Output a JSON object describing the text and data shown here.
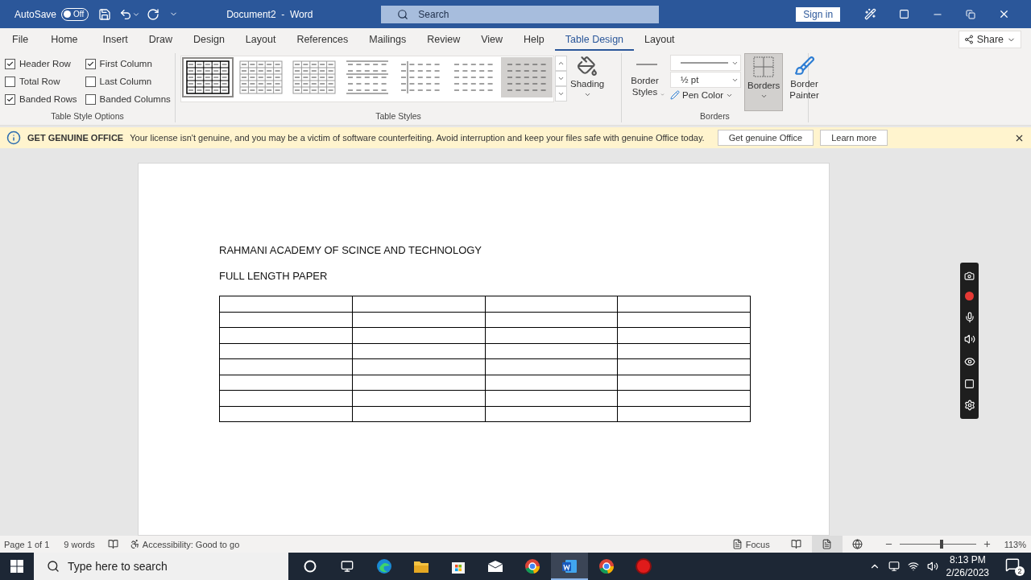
{
  "title_bar": {
    "autosave": "AutoSave",
    "autosave_toggle": {
      "label": "Off",
      "on": false
    },
    "title": "Document2  -  Word",
    "search": {
      "placeholder": "Search"
    },
    "sign_in": "Sign in"
  },
  "tabs": [
    {
      "label": "File",
      "selected": false
    },
    {
      "label": "Home",
      "selected": false
    },
    {
      "label": "Insert",
      "selected": false
    },
    {
      "label": "Draw",
      "selected": false
    },
    {
      "label": "Design",
      "selected": false
    },
    {
      "label": "Layout",
      "selected": false
    },
    {
      "label": "References",
      "selected": false
    },
    {
      "label": "Mailings",
      "selected": false
    },
    {
      "label": "Review",
      "selected": false
    },
    {
      "label": "View",
      "selected": false
    },
    {
      "label": "Help",
      "selected": false
    },
    {
      "label": "Table Design",
      "selected": true
    },
    {
      "label": "Layout",
      "selected": false
    }
  ],
  "share": "Share",
  "table_style_options": {
    "label": "Table Style Options",
    "options": [
      {
        "label": "Header Row",
        "checked": true
      },
      {
        "label": "Total Row",
        "checked": false
      },
      {
        "label": "Banded Rows",
        "checked": true
      },
      {
        "label": "First Column",
        "checked": true
      },
      {
        "label": "Last Column",
        "checked": false
      },
      {
        "label": "Banded Columns",
        "checked": false
      }
    ]
  },
  "table_styles": {
    "label": "Table Styles",
    "styles": [
      {
        "kind": "grid",
        "selected": true
      },
      {
        "kind": "light-grid",
        "selected": false
      },
      {
        "kind": "light-grid",
        "selected": false
      },
      {
        "kind": "lines",
        "selected": false
      },
      {
        "kind": "first-column",
        "selected": false
      },
      {
        "kind": "plain",
        "selected": false
      },
      {
        "kind": "plain",
        "selected": false,
        "hovered": true
      }
    ]
  },
  "shading": "Shading",
  "borders": {
    "label": "Borders",
    "border_styles": "Border Styles",
    "weight": "½ pt",
    "pen_color": "Pen Color",
    "borders_button": {
      "label": "Borders",
      "pressed": true
    },
    "border_painter": "Border Painter"
  },
  "notice": {
    "title": "GET GENUINE OFFICE",
    "message": "Your license isn't genuine, and you may be a victim of software counterfeiting. Avoid interruption and keep your files safe with genuine Office today.",
    "buttons": [
      "Get genuine Office",
      "Learn more"
    ]
  },
  "document": {
    "lines": [
      "RAHMANI ACADEMY OF SCINCE AND TECHNOLOGY",
      "FULL LENGTH PAPER"
    ],
    "table": {
      "rows": [
        [
          {
            "kind": "empty"
          },
          {
            "kind": "empty"
          },
          {
            "kind": "empty"
          },
          {
            "kind": "empty"
          }
        ],
        [
          {
            "kind": "empty"
          },
          {
            "kind": "empty"
          },
          {
            "kind": "empty"
          },
          {
            "kind": "empty"
          }
        ],
        [
          {
            "kind": "empty"
          },
          {
            "kind": "empty"
          },
          {
            "kind": "empty"
          },
          {
            "kind": "empty"
          }
        ],
        [
          {
            "kind": "empty"
          },
          {
            "kind": "empty"
          },
          {
            "kind": "empty"
          },
          {
            "kind": "empty"
          }
        ],
        [
          {
            "kind": "empty"
          },
          {
            "kind": "empty"
          },
          {
            "kind": "empty"
          },
          {
            "kind": "empty"
          }
        ],
        [
          {
            "kind": "empty"
          },
          {
            "kind": "empty"
          },
          {
            "kind": "empty"
          },
          {
            "kind": "empty"
          }
        ],
        [
          {
            "kind": "empty"
          },
          {
            "kind": "empty"
          },
          {
            "kind": "empty"
          },
          {
            "kind": "empty"
          }
        ],
        [
          {
            "kind": "empty"
          },
          {
            "kind": "empty"
          },
          {
            "kind": "empty"
          },
          {
            "kind": "empty"
          }
        ]
      ]
    }
  },
  "status_bar": {
    "page": "Page 1 of 1",
    "words": "9 words",
    "accessibility": "Accessibility: Good to go",
    "focus": "Focus",
    "views": [
      {
        "kind": "read",
        "selected": false
      },
      {
        "kind": "print",
        "selected": true
      },
      {
        "kind": "web",
        "selected": false
      }
    ],
    "zoom": {
      "level": 0.55,
      "reading": "113%"
    }
  },
  "taskbar": {
    "search": {
      "placeholder": "Type here to search"
    },
    "apps": [
      {
        "kind": "cortana",
        "selected": false
      },
      {
        "kind": "task-view",
        "selected": false
      },
      {
        "kind": "edge",
        "selected": false
      },
      {
        "kind": "explorer",
        "selected": false
      },
      {
        "kind": "store",
        "selected": false
      },
      {
        "kind": "mail",
        "selected": false
      },
      {
        "kind": "chrome",
        "selected": false
      },
      {
        "kind": "word",
        "selected": true
      },
      {
        "kind": "chrome",
        "selected": false
      },
      {
        "kind": "recorder",
        "selected": false
      }
    ],
    "time": "8:13 PM",
    "date": "2/26/2023",
    "notifications": "2"
  }
}
